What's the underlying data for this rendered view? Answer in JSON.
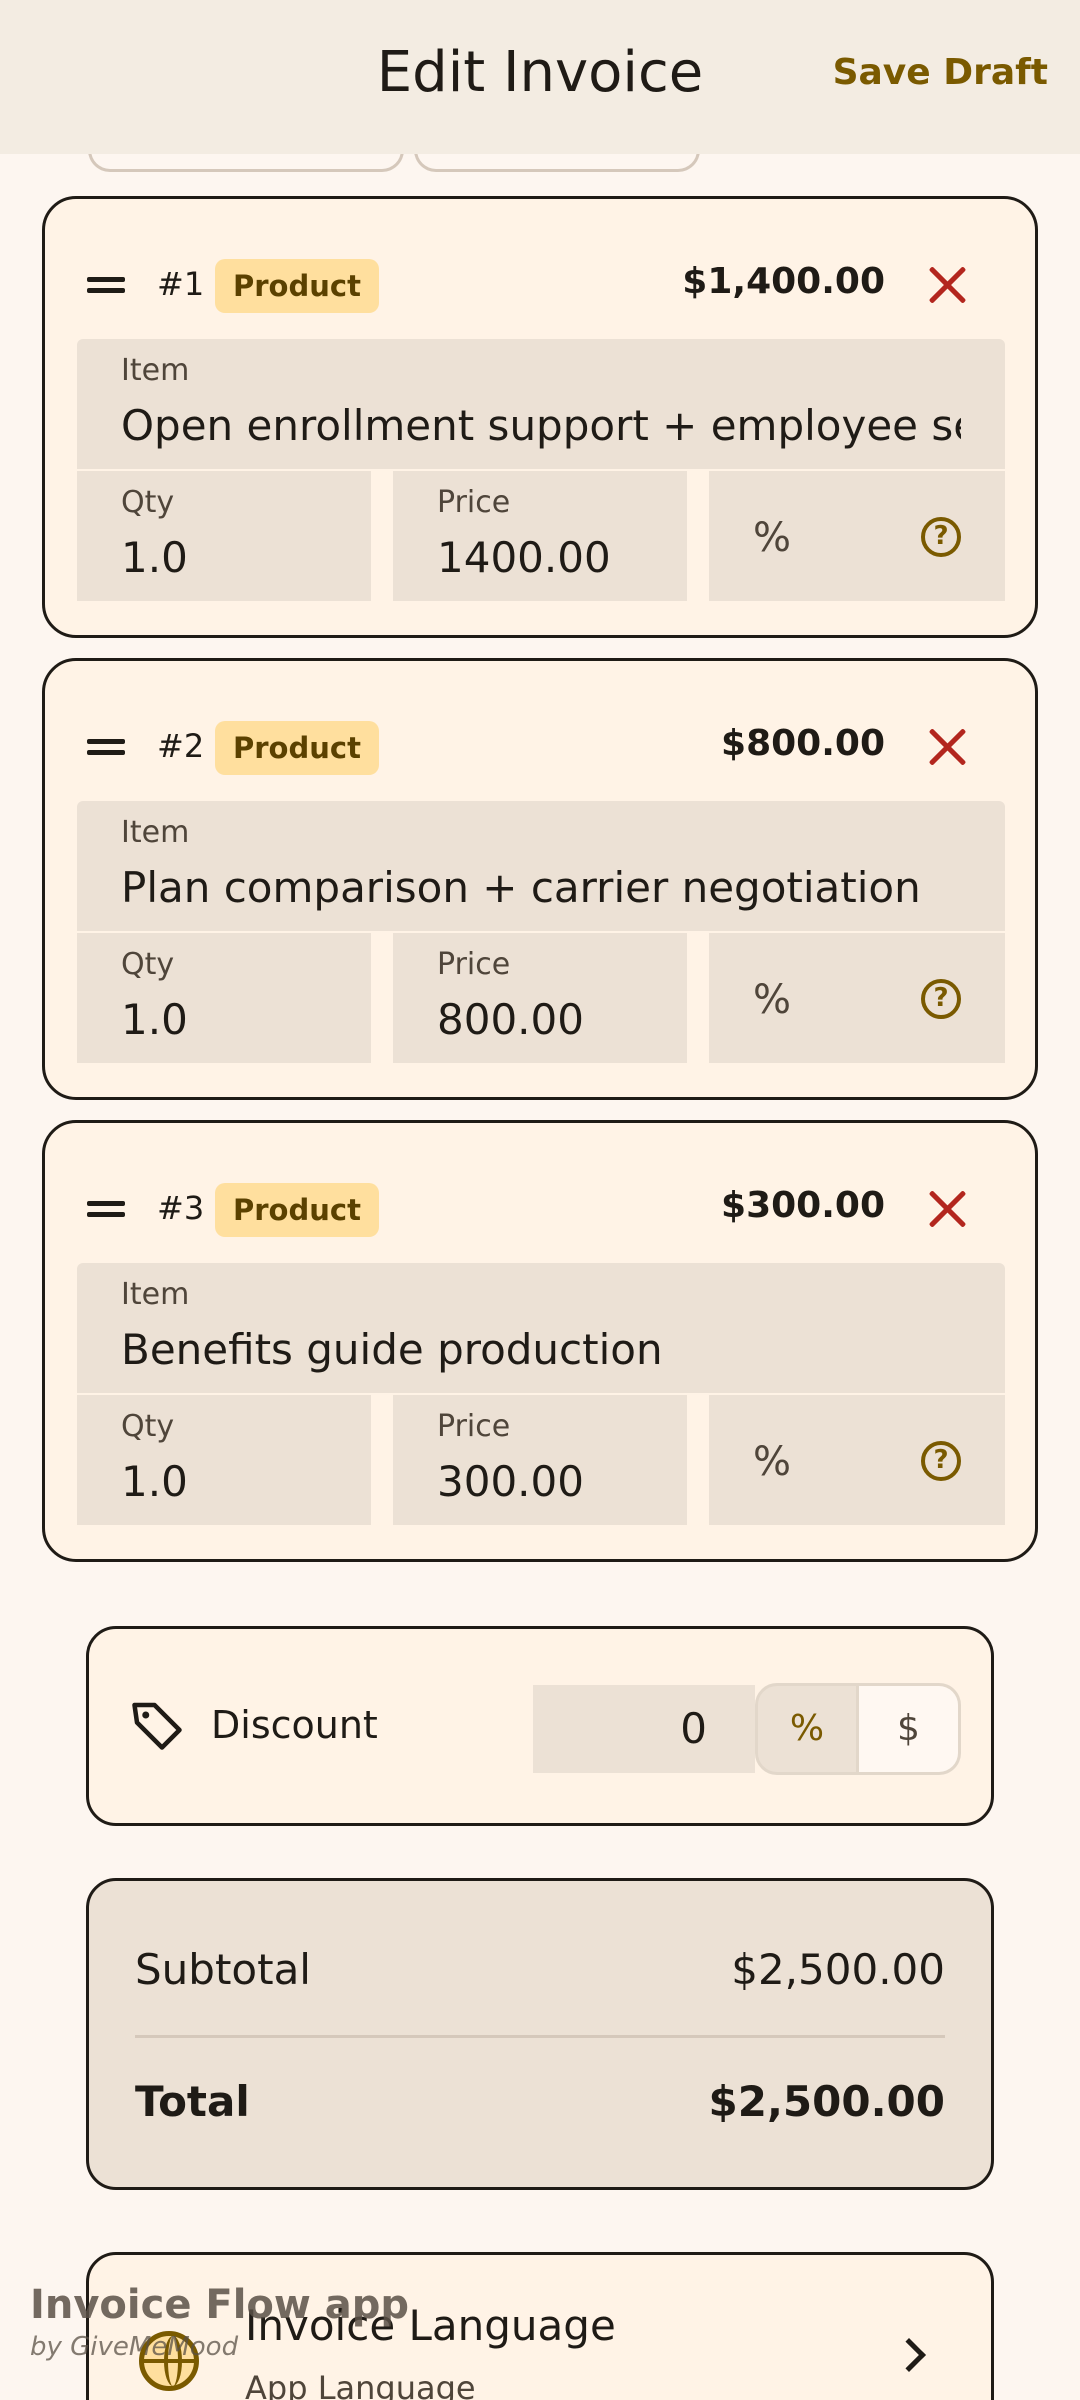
{
  "header": {
    "title": "Edit Invoice",
    "save_draft": "Save Draft"
  },
  "items": [
    {
      "number": "#1",
      "badge": "Product",
      "amount": "$1,400.00",
      "item_label": "Item",
      "item_value": "Open enrollment support + employee ses",
      "qty_label": "Qty",
      "qty": "1.0",
      "price_label": "Price",
      "price": "1400.00",
      "pct": "%"
    },
    {
      "number": "#2",
      "badge": "Product",
      "amount": "$800.00",
      "item_label": "Item",
      "item_value": "Plan comparison + carrier negotiation",
      "qty_label": "Qty",
      "qty": "1.0",
      "price_label": "Price",
      "price": "800.00",
      "pct": "%"
    },
    {
      "number": "#3",
      "badge": "Product",
      "amount": "$300.00",
      "item_label": "Item",
      "item_value": "Benefits guide production",
      "qty_label": "Qty",
      "qty": "1.0",
      "price_label": "Price",
      "price": "300.00",
      "pct": "%"
    }
  ],
  "discount": {
    "label": "Discount",
    "value": "0",
    "pct": "%",
    "usd": "$"
  },
  "totals": {
    "subtotal_label": "Subtotal",
    "subtotal": "$2,500.00",
    "total_label": "Total",
    "total": "$2,500.00"
  },
  "language": {
    "title": "Invoice Language",
    "subtitle": "App Language"
  },
  "watermark": {
    "line1": "Invoice Flow app",
    "line2": "by GiveMeMood"
  },
  "colors": {
    "accent": "#7a5a00",
    "badge_bg": "#ffdf9e",
    "remove": "#b3261e",
    "field_bg": "#ece1d5"
  }
}
